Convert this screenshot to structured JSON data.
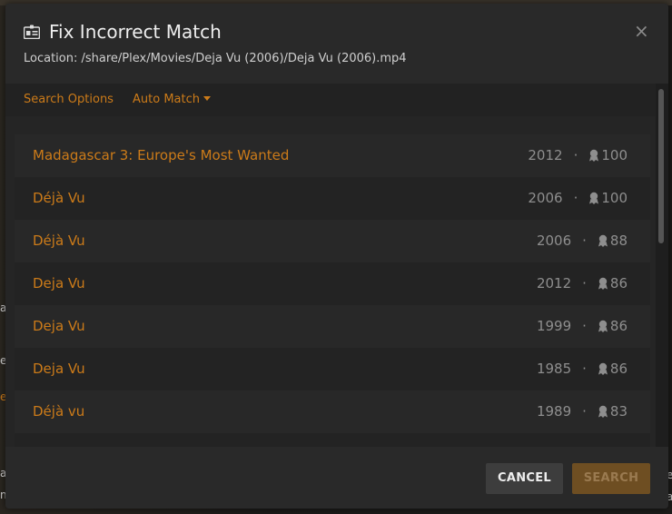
{
  "background": {
    "fragments": [
      "a",
      "er",
      "e",
      "a",
      "ne",
      "e",
      "a"
    ]
  },
  "dialog": {
    "title": "Fix Incorrect Match",
    "location": "Location: /share/Plex/Movies/Deja Vu (2006)/Deja Vu (2006).mp4",
    "close_label": "×"
  },
  "search_options": {
    "search_options_label": "Search Options",
    "auto_match_label": "Auto Match"
  },
  "results": [
    {
      "title": "Madagascar 3: Europe's Most Wanted",
      "year": "2012",
      "score": "100"
    },
    {
      "title": "Déjà Vu",
      "year": "2006",
      "score": "100"
    },
    {
      "title": "Déjà Vu",
      "year": "2006",
      "score": "88"
    },
    {
      "title": "Deja Vu",
      "year": "2012",
      "score": "86"
    },
    {
      "title": "Deja Vu",
      "year": "1999",
      "score": "86"
    },
    {
      "title": "Deja Vu",
      "year": "1985",
      "score": "86"
    },
    {
      "title": "Déjà vu",
      "year": "1989",
      "score": "83"
    }
  ],
  "separator": "·",
  "footer": {
    "cancel_label": "CANCEL",
    "search_label": "SEARCH"
  },
  "colors": {
    "accent": "#cc7b19",
    "dialog_bg": "#292929",
    "muted_text": "#8e8e8e"
  }
}
